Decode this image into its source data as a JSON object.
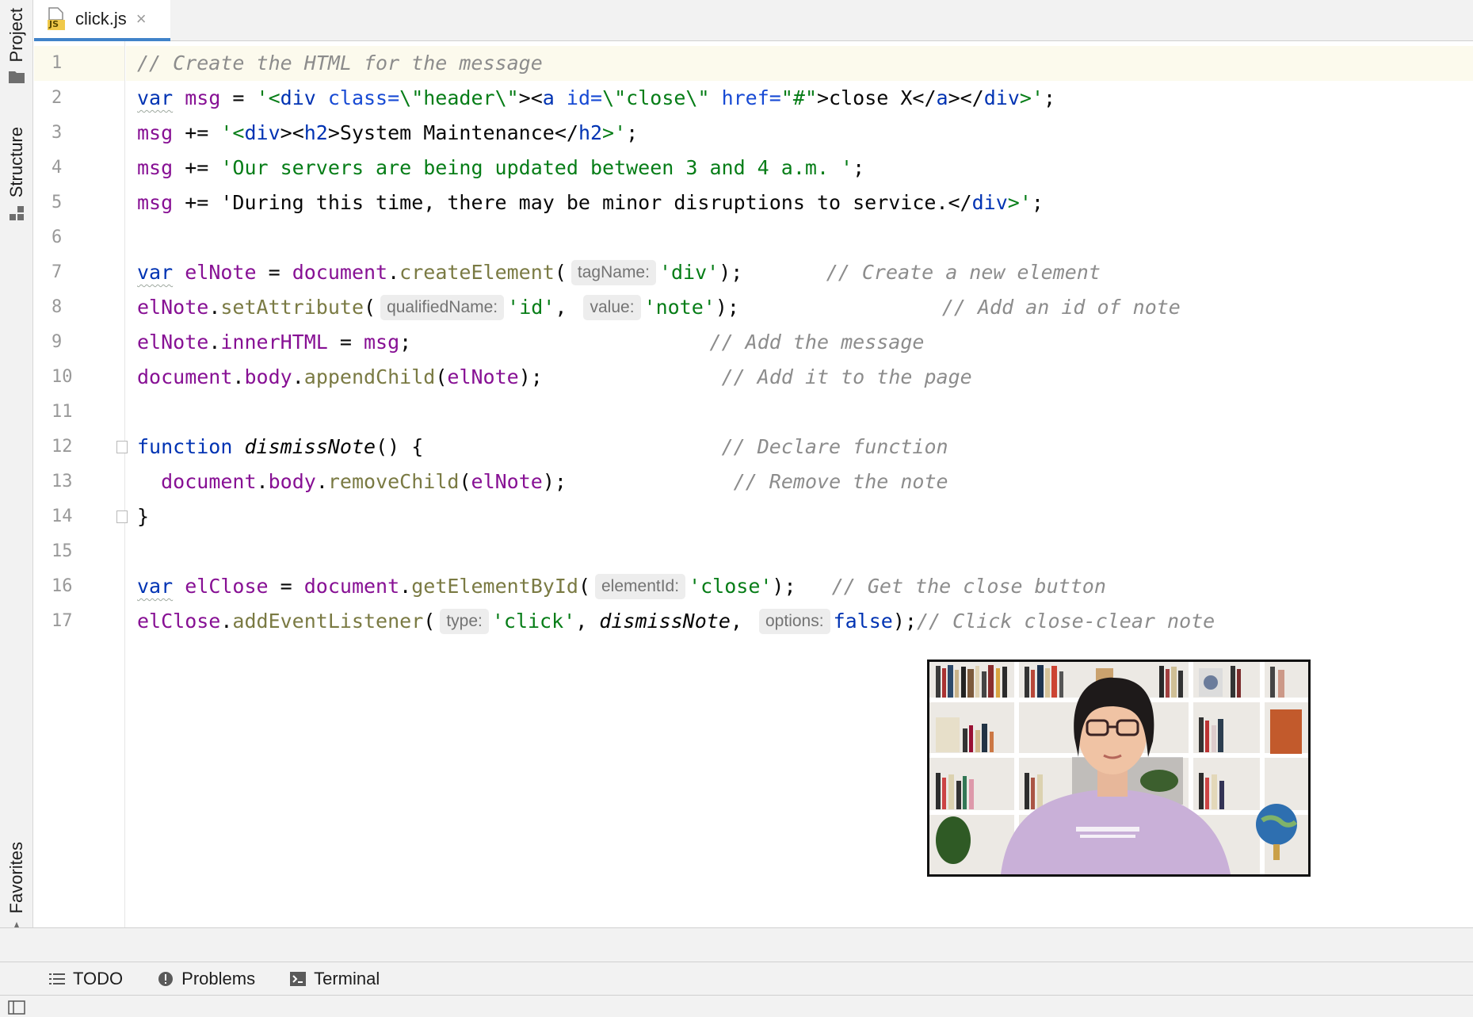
{
  "left_stripe": {
    "project_label": "Project",
    "structure_label": "Structure",
    "favorites_label": "Favorites"
  },
  "tab": {
    "label": "click.js",
    "icon_text": "JS",
    "close_glyph": "×"
  },
  "gutter": {
    "line_numbers": [
      "1",
      "2",
      "3",
      "4",
      "5",
      "6",
      "7",
      "8",
      "9",
      "10",
      "11",
      "12",
      "13",
      "14",
      "15",
      "16",
      "17"
    ]
  },
  "code": {
    "l1_comment": "// Create the HTML for the message",
    "l2_kw": "var",
    "l2_var": "msg",
    "l2_eq": " = ",
    "l2_s1": "'<",
    "l2_tag_div": "div",
    "l2_attr_class": " class=",
    "l2_s2": "\\\"header\\\"",
    "l2_s3": "><",
    "l2_tag_a": "a",
    "l2_attr_id": " id=",
    "l2_s4": "\\\"close\\\"",
    "l2_attr_href": " href=",
    "l2_s5": "\"#\"",
    "l2_s6": ">close X</",
    "l2_tag_a2": "a",
    "l2_s7": "></",
    "l2_tag_div2": "div",
    "l2_s8": ">'",
    "l2_end": ";",
    "l3_var": "msg",
    "l3_op": " += ",
    "l3_s1": "'<",
    "l3_tag_div": "div",
    "l3_s2": "><",
    "l3_tag_h2": "h2",
    "l3_s3": ">System Maintenance</",
    "l3_tag_h2b": "h2",
    "l3_s4": ">'",
    "l3_end": ";",
    "l4_var": "msg",
    "l4_op": " += ",
    "l4_str": "'Our servers are being updated between 3 and 4 a.m. '",
    "l4_end": ";",
    "l5_var": "msg",
    "l5_op": " += ",
    "l5_s1": "'During this time, there may be minor disruptions to service.</",
    "l5_tag_div": "div",
    "l5_s2": ">'",
    "l5_end": ";",
    "l7_kw": "var",
    "l7_var": "elNote",
    "l7_eq": " = ",
    "l7_obj": "document",
    "l7_dot": ".",
    "l7_meth": "createElement",
    "l7_open": "(",
    "l7_hint": "tagName:",
    "l7_str": "'div'",
    "l7_close": ");",
    "l7_pad": "       ",
    "l7_comment": "// Create a new element",
    "l8_var": "elNote",
    "l8_dot": ".",
    "l8_meth": "setAttribute",
    "l8_open": "(",
    "l8_hint1": "qualifiedName:",
    "l8_str1": "'id'",
    "l8_comma": ", ",
    "l8_hint2": "value:",
    "l8_str2": "'note'",
    "l8_close": ");",
    "l8_pad": "                 ",
    "l8_comment": "// Add an id of note",
    "l9_var": "elNote",
    "l9_dot": ".",
    "l9_prop": "innerHTML",
    "l9_eq": " = ",
    "l9_val": "msg",
    "l9_end": ";",
    "l9_pad": "                         ",
    "l9_comment": "// Add the message",
    "l10_obj": "document",
    "l10_dot": ".",
    "l10_prop": "body",
    "l10_dot2": ".",
    "l10_meth": "appendChild",
    "l10_open": "(",
    "l10_arg": "elNote",
    "l10_close": ");",
    "l10_pad": "               ",
    "l10_comment": "// Add it to the page",
    "l12_kw": "function",
    "l12_sp": " ",
    "l12_fn": "dismissNote",
    "l12_rest": "() {",
    "l12_pad": "                         ",
    "l12_comment": "// Declare function",
    "l13_indent": "  ",
    "l13_obj": "document",
    "l13_dot": ".",
    "l13_prop": "body",
    "l13_dot2": ".",
    "l13_meth": "removeChild",
    "l13_open": "(",
    "l13_arg": "elNote",
    "l13_close": ");",
    "l13_pad": "              ",
    "l13_comment": "// Remove the note",
    "l14_brace": "}",
    "l16_kw": "var",
    "l16_var": "elClose",
    "l16_eq": " = ",
    "l16_obj": "document",
    "l16_dot": ".",
    "l16_meth": "getElementById",
    "l16_open": "(",
    "l16_hint": "elementId:",
    "l16_str": "'close'",
    "l16_close": ");",
    "l16_pad": "   ",
    "l16_comment": "// Get the close button",
    "l17_var": "elClose",
    "l17_dot": ".",
    "l17_meth": "addEventListener",
    "l17_open": "(",
    "l17_hint1": "type:",
    "l17_str": "'click'",
    "l17_comma": ", ",
    "l17_fn": "dismissNote",
    "l17_comma2": ", ",
    "l17_hint2": "options:",
    "l17_false": "false",
    "l17_close": ");",
    "l17_comment": "// Click close-clear note"
  },
  "bottom_toolbar": {
    "todo": "TODO",
    "problems": "Problems",
    "terminal": "Terminal"
  },
  "colors": {
    "keyword": "#0033b3",
    "string": "#067d17",
    "variable": "#871094",
    "method": "#7a7a43",
    "comment": "#8c8c8c",
    "current_line": "#fcfaed",
    "tab_accent": "#4083c9"
  },
  "icons": {
    "project": "folder-icon",
    "structure": "structure-icon",
    "favorites": "star-icon",
    "todo": "list-icon",
    "problems": "exclamation-icon",
    "terminal": "terminal-icon",
    "status": "layout-toggle-icon"
  }
}
